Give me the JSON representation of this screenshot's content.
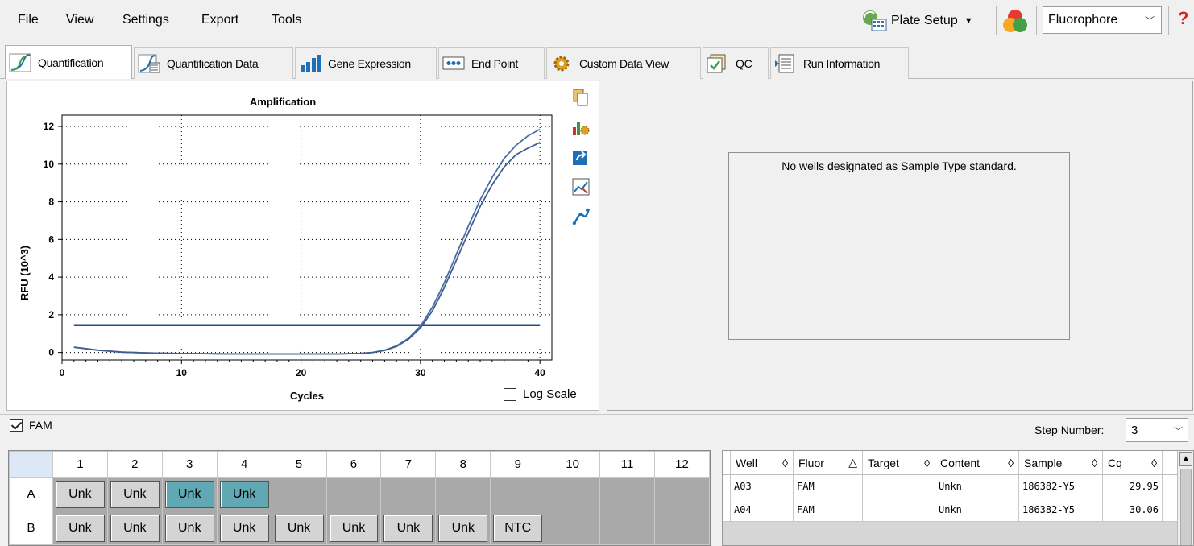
{
  "menu": [
    "File",
    "View",
    "Settings",
    "Export",
    "Tools"
  ],
  "toolbar": {
    "plate_setup": "Plate Setup",
    "fluorophore": "Fluorophore"
  },
  "tabs": [
    {
      "label": "Quantification",
      "icon": "amplification-curve-icon",
      "active": true
    },
    {
      "label": "Quantification Data",
      "icon": "quantification-data-icon"
    },
    {
      "label": "Gene Expression",
      "icon": "bar-chart-icon"
    },
    {
      "label": "End Point",
      "icon": "end-point-icon"
    },
    {
      "label": "Custom Data View",
      "icon": "gear-icon"
    },
    {
      "label": "QC",
      "icon": "qc-check-icon"
    },
    {
      "label": "Run Information",
      "icon": "document-icon"
    }
  ],
  "standard_curve": {
    "message": "No wells designated as Sample Type standard."
  },
  "log_scale_label": "Log Scale",
  "fam_label": "FAM",
  "step": {
    "label": "Step Number:",
    "value": "3"
  },
  "plate": {
    "columns": [
      "1",
      "2",
      "3",
      "4",
      "5",
      "6",
      "7",
      "8",
      "9",
      "10",
      "11",
      "12"
    ],
    "rows": [
      {
        "label": "A",
        "wells": [
          "Unk",
          "Unk",
          "Unk",
          "Unk",
          "",
          "",
          "",
          "",
          "",
          "",
          "",
          ""
        ],
        "selected": [
          2,
          3
        ]
      },
      {
        "label": "B",
        "wells": [
          "Unk",
          "Unk",
          "Unk",
          "Unk",
          "Unk",
          "Unk",
          "Unk",
          "Unk",
          "NTC",
          "",
          "",
          ""
        ],
        "selected": []
      }
    ]
  },
  "results_table": {
    "headers": [
      "Well",
      "Fluor",
      "Target",
      "Content",
      "Sample",
      "Cq"
    ],
    "rows": [
      [
        "A03",
        "FAM",
        "",
        "Unkn",
        "186382-Y5",
        "29.95"
      ],
      [
        "A04",
        "FAM",
        "",
        "Unkn",
        "186382-Y5",
        "30.06"
      ]
    ]
  },
  "chart_data": {
    "type": "line",
    "title": "Amplification",
    "xlabel": "Cycles",
    "ylabel": "RFU (10^3)",
    "xlim": [
      0,
      41
    ],
    "ylim": [
      -0.4,
      12.6
    ],
    "xticks": [
      0,
      10,
      20,
      30,
      40
    ],
    "yticks": [
      0,
      2,
      4,
      6,
      8,
      10,
      12
    ],
    "grid": "dotted",
    "threshold": 1.45,
    "series": [
      {
        "x": [
          1,
          3,
          5,
          7,
          9,
          11,
          13,
          15,
          17,
          19,
          21,
          23,
          25,
          26,
          27,
          28,
          29,
          30,
          31,
          32,
          33,
          34,
          35,
          36,
          37,
          38,
          39,
          40
        ],
        "values": [
          0.28,
          0.12,
          0.02,
          -0.02,
          -0.05,
          -0.06,
          -0.07,
          -0.08,
          -0.08,
          -0.08,
          -0.08,
          -0.08,
          -0.05,
          0.0,
          0.12,
          0.35,
          0.75,
          1.4,
          2.4,
          3.7,
          5.2,
          6.7,
          8.1,
          9.3,
          10.3,
          11.0,
          11.5,
          11.85
        ]
      },
      {
        "x": [
          1,
          3,
          5,
          7,
          9,
          11,
          13,
          15,
          17,
          19,
          21,
          23,
          25,
          26,
          27,
          28,
          29,
          30,
          31,
          32,
          33,
          34,
          35,
          36,
          37,
          38,
          39,
          40
        ],
        "values": [
          0.28,
          0.12,
          0.02,
          -0.02,
          -0.05,
          -0.06,
          -0.07,
          -0.08,
          -0.08,
          -0.08,
          -0.08,
          -0.08,
          -0.05,
          0.0,
          0.11,
          0.32,
          0.7,
          1.3,
          2.2,
          3.45,
          4.9,
          6.35,
          7.75,
          8.9,
          9.85,
          10.5,
          10.85,
          11.15
        ]
      }
    ]
  }
}
